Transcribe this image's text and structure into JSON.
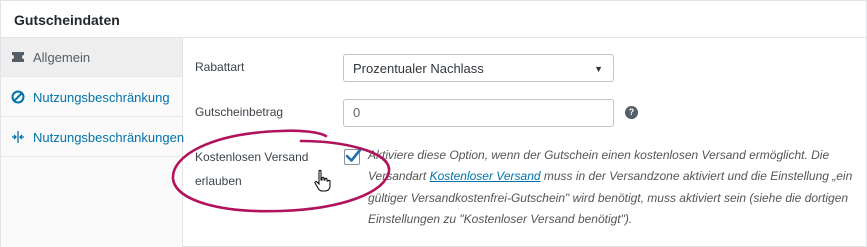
{
  "panel": {
    "title": "Gutscheindaten"
  },
  "tabs": [
    {
      "label": "Allgemein",
      "icon": "ticket-icon",
      "active": true
    },
    {
      "label": "Nutzungsbeschränkung",
      "icon": "no-entry-icon",
      "active": false
    },
    {
      "label": "Nutzungsbeschränkungen",
      "icon": "arrows-horizontal-icon",
      "active": false
    }
  ],
  "fields": {
    "discount_type": {
      "label": "Rabattart",
      "value": "Prozentualer Nachlass",
      "arrow": "▼"
    },
    "amount": {
      "label": "Gutscheinbetrag",
      "value": "0",
      "help": "?"
    },
    "free_shipping": {
      "label_line1": "Kostenlosen Versand",
      "label_line2": "erlauben",
      "checked": true,
      "desc_part1": "Aktiviere diese Option, wenn der Gutschein einen kostenlosen Versand ermöglicht. Die Versandart ",
      "desc_link": "Kostenloser Versand",
      "desc_part2": " muss in der Versandzone aktiviert und die Einstellung „ein gültiger Versandkostenfrei-Gutschein\" wird benötigt, muss aktiviert sein (siehe die dortigen Einstellungen zu \"Kostenloser Versand benötigt\")."
    }
  },
  "colors": {
    "highlight": "#b0135c",
    "link": "#0073aa",
    "checkmark": "#2271b1"
  }
}
